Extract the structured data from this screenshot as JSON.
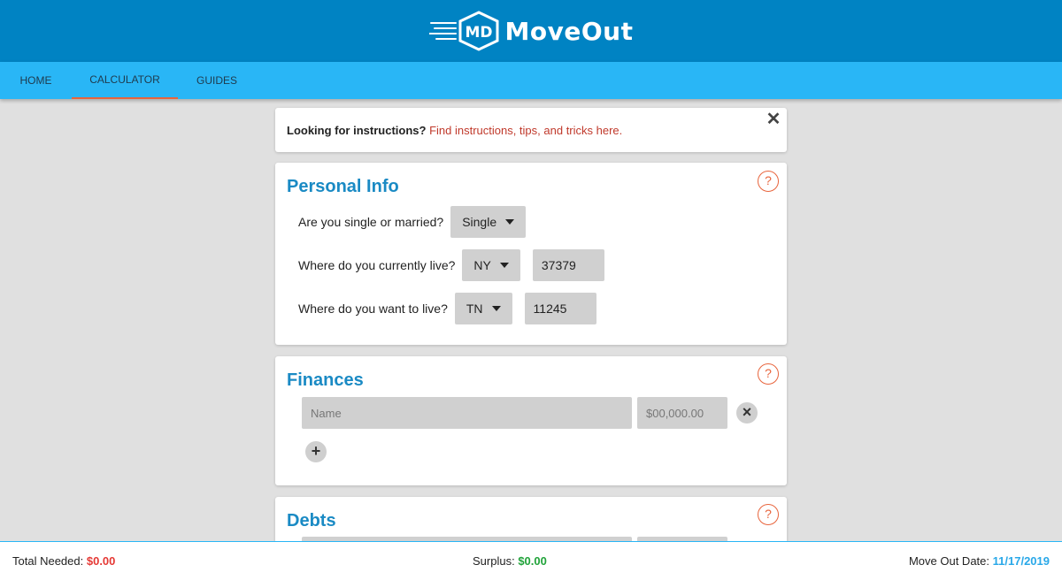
{
  "header": {
    "brand": "MoveOut",
    "logo_monogram": "MD"
  },
  "nav": {
    "tabs": [
      {
        "label": "HOME"
      },
      {
        "label": "CALCULATOR"
      },
      {
        "label": "GUIDES"
      }
    ]
  },
  "banner": {
    "lead": "Looking for instructions?",
    "link": "Find instructions, tips, and tricks here.",
    "close_icon": "close-icon"
  },
  "personal": {
    "title": "Personal Info",
    "help": "?",
    "status_label": "Are you single or married?",
    "status_value": "Single",
    "current_label": "Where do you currently live?",
    "current_state": "NY",
    "current_zip": "37379",
    "want_label": "Where do you want to live?",
    "want_state": "TN",
    "want_zip": "11245"
  },
  "finances": {
    "title": "Finances",
    "help": "?",
    "name_placeholder": "Name",
    "amount_placeholder": "$00,000.00",
    "remove_icon": "×",
    "add_icon": "+"
  },
  "debts": {
    "title": "Debts",
    "help": "?"
  },
  "footer": {
    "total_label": "Total Needed:",
    "total_value": "$0.00",
    "surplus_label": "Surplus:",
    "surplus_value": "$0.00",
    "date_label": "Move Out Date:",
    "date_value": "11/17/2019"
  },
  "colors": {
    "header": "#0083c3",
    "nav": "#29b6f6",
    "accent": "#e8643c",
    "title": "#1a8ac4"
  }
}
